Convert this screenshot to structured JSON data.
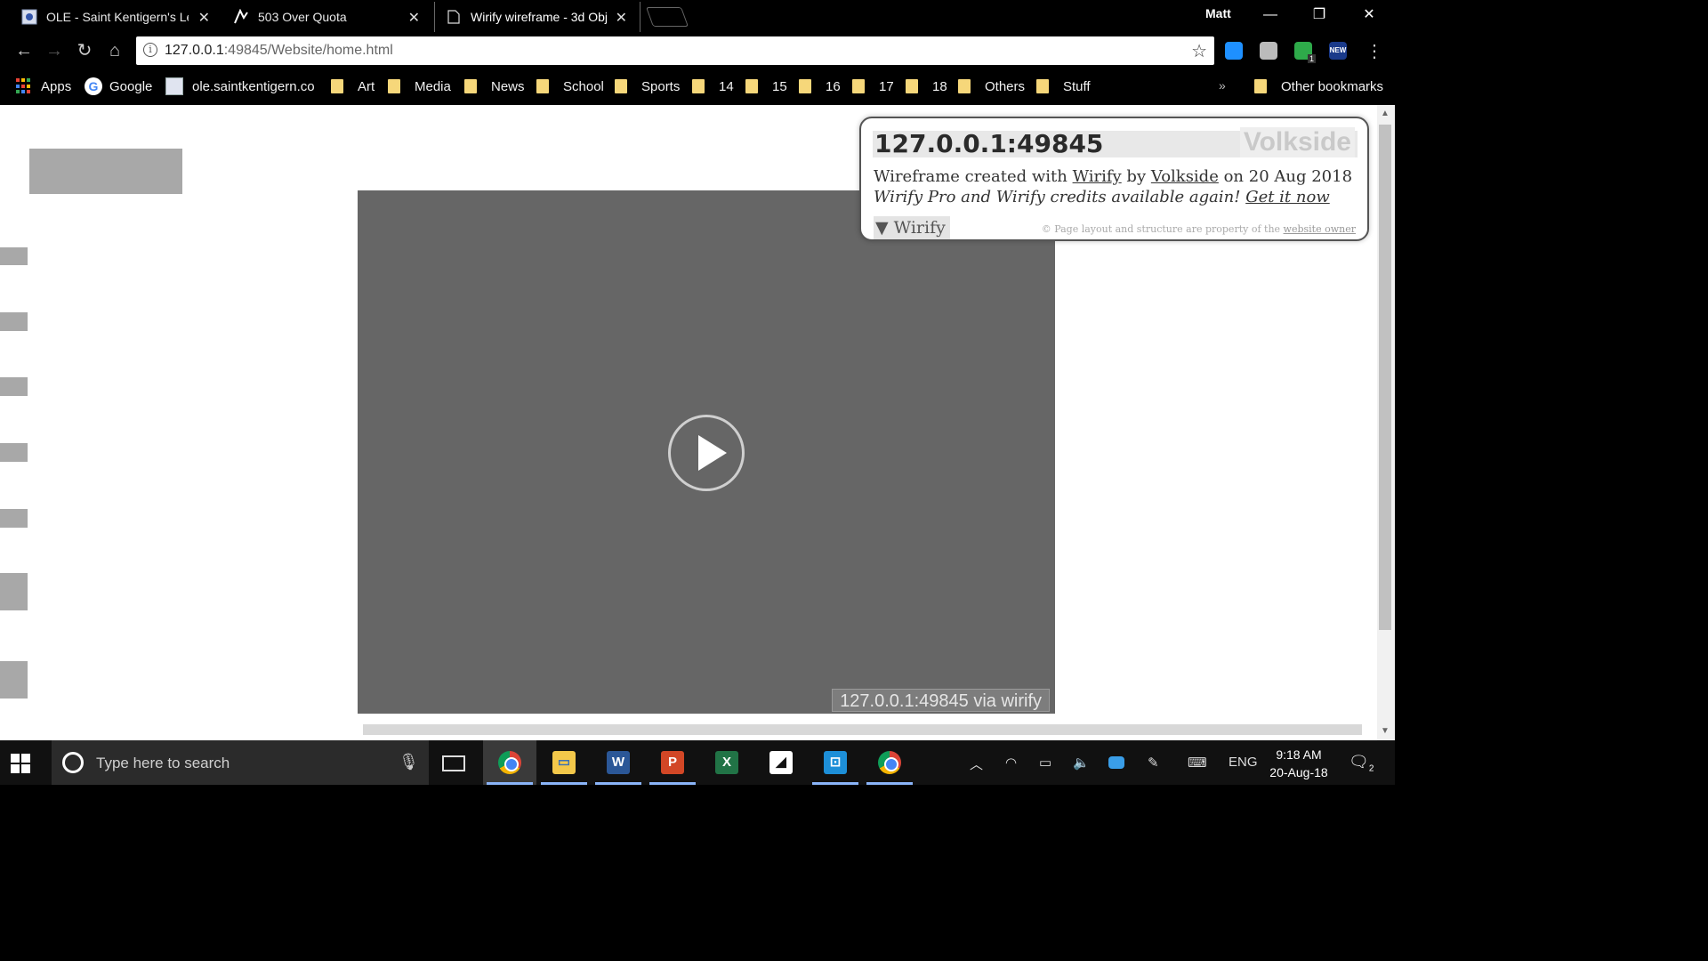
{
  "browser": {
    "tabs": [
      {
        "title": "OLE - Saint Kentigern's Le",
        "active": false
      },
      {
        "title": "503 Over Quota",
        "active": false
      },
      {
        "title": "Wirify wireframe - 3d Obj",
        "active": true
      }
    ],
    "profile_name": "Matt",
    "window_controls": {
      "minimize": "—",
      "restore": "❐",
      "close": "✕"
    },
    "url_host": "127.0.0.1",
    "url_rest": ":49845/Website/home.html",
    "extensions": [
      {
        "name": "onedrive-extension-icon",
        "badge": ""
      },
      {
        "name": "extension-icon",
        "badge": ""
      },
      {
        "name": "shield-extension-icon",
        "badge": "1"
      },
      {
        "name": "new-extension-icon",
        "badge": "NEW"
      }
    ]
  },
  "bookmarks": {
    "apps_label": "Apps",
    "google_label": "Google",
    "ole_label": "ole.saintkentigern.co",
    "folders": [
      "Art",
      "Media",
      "News",
      "School",
      "Sports",
      "14",
      "15",
      "16",
      "17",
      "18",
      "Others",
      "Stuff"
    ],
    "overflow": "»",
    "other_label": "Other bookmarks"
  },
  "page": {
    "video_caption": "127.0.0.1:49845 via wirify"
  },
  "wirify": {
    "host": "127.0.0.1:49845",
    "logo": "Volkside",
    "line1_prefix": "Wireframe created with ",
    "line1_link1": "Wirify",
    "line1_mid": " by ",
    "line1_link2": "Volkside",
    "line1_suffix": " on 20 Aug 2018",
    "line2_text": "Wirify Pro and Wirify credits available again! ",
    "line2_link": "Get it now",
    "toggle_label": "▼ Wirify",
    "copyright_prefix": "© Page layout and structure are property of the ",
    "copyright_link": "website owner"
  },
  "taskbar": {
    "search_placeholder": "Type here to search",
    "apps": [
      "chrome",
      "file-explorer",
      "word",
      "powerpoint",
      "excel",
      "sticky-notes",
      "snipping",
      "chrome-2"
    ],
    "tray": {
      "language": "ENG"
    },
    "clock": {
      "time": "9:18 AM",
      "date": "20-Aug-18"
    },
    "notification_count": "2"
  },
  "colors": {
    "chrome_bg": "#000000",
    "wireframe_gray": "#a8a8a8",
    "video_gray": "#666666",
    "folder_yellow": "#f6d77a"
  }
}
